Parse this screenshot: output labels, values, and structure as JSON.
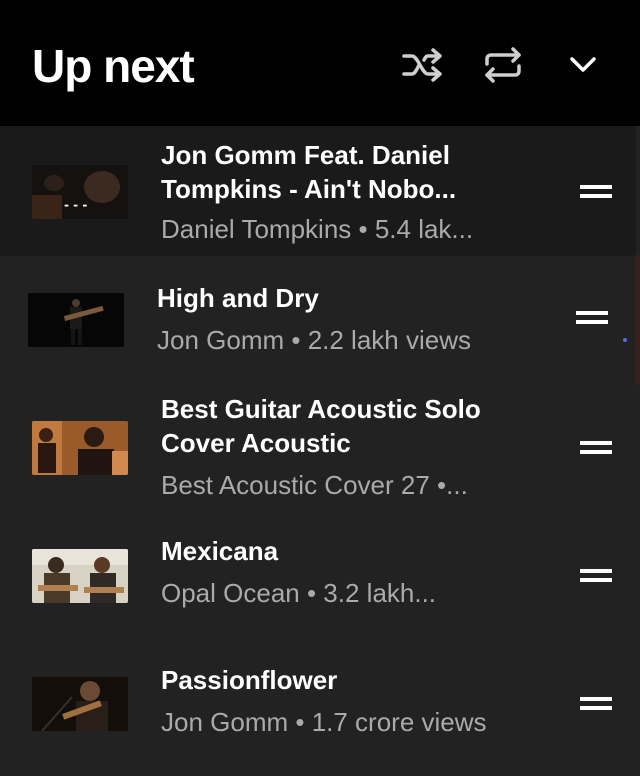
{
  "header": {
    "title": "Up next",
    "icons": [
      "shuffle-icon",
      "repeat-icon",
      "collapse-chevron-icon"
    ]
  },
  "items": [
    {
      "title": "Jon Gomm Feat. Daniel\nTompkins - Ain't Nobo...",
      "subtitle": "Daniel Tompkins • 5.4 lak...",
      "thumb_overlay": "- - -"
    },
    {
      "title": "High and Dry",
      "subtitle": "Jon Gomm • 2.2 lakh views"
    },
    {
      "title": "Best Guitar Acoustic Solo\nCover Acoustic",
      "subtitle": "Best Acoustic Cover 27 •..."
    },
    {
      "title": "Mexicana",
      "subtitle": "Opal Ocean • 3.2 lakh..."
    },
    {
      "title": "Passionflower",
      "subtitle": "Jon Gomm • 1.7 crore views"
    }
  ],
  "colors": {
    "header_bg": "#000000",
    "list_bg": "#222222",
    "active_row_bg": "#1a1a1a",
    "title": "#ffffff",
    "subtitle": "#aaaaaa"
  }
}
